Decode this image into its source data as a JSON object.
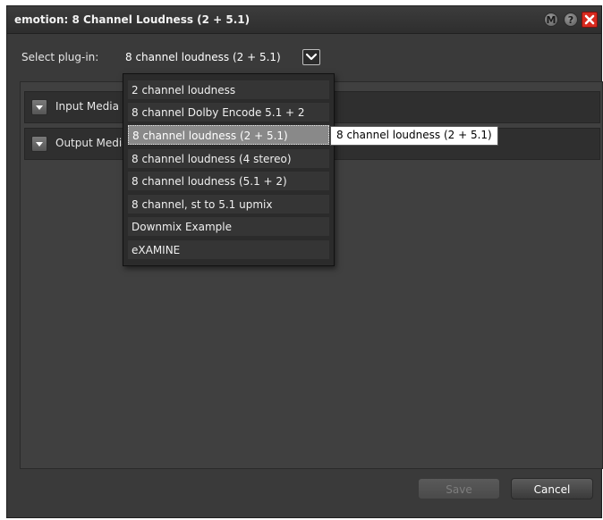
{
  "window": {
    "title": "emotion: 8 Channel Loudness (2 + 5.1)"
  },
  "titlebar_buttons": {
    "m_label": "M",
    "help_label": "?"
  },
  "select": {
    "label": "Select plug-in:",
    "value": "8 channel loudness (2 + 5.1)"
  },
  "sections": [
    {
      "label": "Input Media"
    },
    {
      "label": "Output Media"
    }
  ],
  "dropdown": {
    "options": [
      "2 channel loudness",
      "8 channel Dolby Encode 5.1 + 2",
      "8 channel loudness (2 + 5.1)",
      "8 channel loudness (4 stereo)",
      "8 channel loudness (5.1 + 2)",
      "8 channel, st to 5.1 upmix",
      "Downmix Example",
      "eXAMINE"
    ],
    "selected_index": 2
  },
  "tooltip": {
    "text": "8 channel loudness (2 + 5.1)"
  },
  "footer": {
    "save_label": "Save",
    "cancel_label": "Cancel"
  },
  "colors": {
    "close": "#d82a1e",
    "window_bg": "#3a3a3a",
    "highlight": "#898989"
  },
  "icons": {
    "close": "close-icon",
    "dropdown": "chevron-down-icon",
    "expander": "triangle-down-icon"
  }
}
